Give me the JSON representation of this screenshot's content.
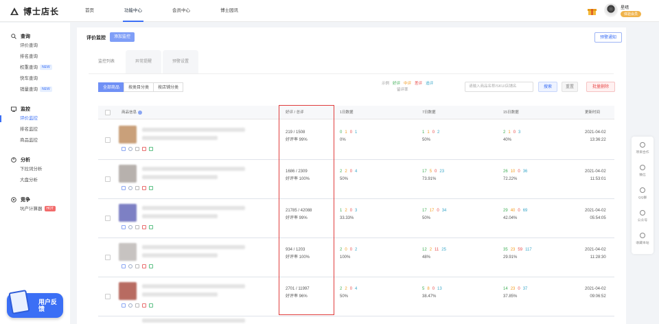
{
  "header": {
    "logo_text": "博士店长",
    "nav": [
      {
        "label": "首页"
      },
      {
        "label": "功能中心",
        "active": true
      },
      {
        "label": "会员中心"
      },
      {
        "label": "博士园讯"
      }
    ],
    "user_name": "星晴",
    "user_badge": "体验会员"
  },
  "sidebar": {
    "groups": [
      {
        "title": "查询",
        "icon": "search-icon",
        "items": [
          {
            "label": "评价查询"
          },
          {
            "label": "排名查询"
          },
          {
            "label": "权重查询",
            "tag": "NEW"
          },
          {
            "label": "快车查询"
          },
          {
            "label": "销量查询",
            "tag": "NEW"
          }
        ]
      },
      {
        "title": "监控",
        "icon": "monitor-icon",
        "items": [
          {
            "label": "评价监控",
            "active": true
          },
          {
            "label": "排名监控"
          },
          {
            "label": "商品监控"
          }
        ]
      },
      {
        "title": "分析",
        "icon": "analysis-icon",
        "items": [
          {
            "label": "下拉词分析"
          },
          {
            "label": "大盘分析"
          }
        ]
      },
      {
        "title": "竞争",
        "icon": "compete-icon",
        "items": [
          {
            "label": "坑产计算器",
            "tag": "HOT"
          }
        ]
      }
    ],
    "feedback_label": "用户反馈"
  },
  "main": {
    "title": "评价监控",
    "add_button": "添加监控",
    "warn_button": "预警通知",
    "tabs": [
      "监控列表",
      "异常提醒",
      "预警设置"
    ],
    "filters": [
      "全部商品",
      "按类目分类",
      "按店铺分类"
    ],
    "legend_prefix": "示例",
    "legend": {
      "good": "好评",
      "mid": "中评",
      "bad": "差评",
      "add": "追评"
    },
    "legend_suffix": "留评率",
    "search_placeholder": "请输入商品名称/SKU/店铺名",
    "search_button": "搜索",
    "reset_button": "重置",
    "batch_delete_button": "批量删除",
    "columns": {
      "product": "商品信息",
      "ratio": "好评 / 总评",
      "day1": "1日数据",
      "day7": "7日数据",
      "day15": "15日数据",
      "updated": "更新时间"
    },
    "rows": [
      {
        "ratio": "219 / 1508",
        "rate": "好评率 99%",
        "d1": [
          "0",
          "1",
          "0",
          "1"
        ],
        "d1_pct": "0%",
        "d7": [
          "1",
          "1",
          "0",
          "2"
        ],
        "d7_pct": "50%",
        "d15": [
          "2",
          "1",
          "0",
          "3"
        ],
        "d15_pct": "40%",
        "date": "2021-04-02",
        "time": "13:36:22"
      },
      {
        "ratio": "1686 / 2309",
        "rate": "好评率 100%",
        "d1": [
          "2",
          "2",
          "0",
          "4"
        ],
        "d1_pct": "50%",
        "d7": [
          "17",
          "5",
          "0",
          "23"
        ],
        "d7_pct": "73.91%",
        "d15": [
          "26",
          "10",
          "0",
          "36"
        ],
        "d15_pct": "72.22%",
        "date": "2021-04-02",
        "time": "11:53:01"
      },
      {
        "ratio": "21785 / 42088",
        "rate": "好评率 99%",
        "d1": [
          "1",
          "2",
          "0",
          "3"
        ],
        "d1_pct": "33.33%",
        "d7": [
          "17",
          "17",
          "0",
          "34"
        ],
        "d7_pct": "50%",
        "d15": [
          "29",
          "40",
          "0",
          "69"
        ],
        "d15_pct": "42.04%",
        "date": "2021-04-02",
        "time": "05:54:05"
      },
      {
        "ratio": "934 / 1203",
        "rate": "好评率 100%",
        "d1": [
          "2",
          "0",
          "0",
          "2"
        ],
        "d1_pct": "100%",
        "d7": [
          "12",
          "2",
          "11",
          "25"
        ],
        "d7_pct": "48%",
        "d15": [
          "35",
          "23",
          "59",
          "117"
        ],
        "d15_pct": "29.91%",
        "date": "2021-04-02",
        "time": "11:28:30"
      },
      {
        "ratio": "2701 / 11997",
        "rate": "好评率 96%",
        "d1": [
          "2",
          "2",
          "0",
          "4"
        ],
        "d1_pct": "50%",
        "d7": [
          "5",
          "8",
          "0",
          "13"
        ],
        "d7_pct": "38.47%",
        "d15": [
          "14",
          "23",
          "0",
          "37"
        ],
        "d15_pct": "37.85%",
        "date": "2021-04-02",
        "time": "09:06:52"
      }
    ]
  },
  "rightbar": [
    "项目合作",
    "微信",
    "QQ群",
    "公众号",
    "收藏本站"
  ],
  "colors": {
    "primary": "#3b6ff5",
    "good": "#3fae56",
    "mid": "#f29c1f",
    "bad": "#e84c4c",
    "add": "#39a7c9",
    "highlight": "#e03b3b"
  }
}
